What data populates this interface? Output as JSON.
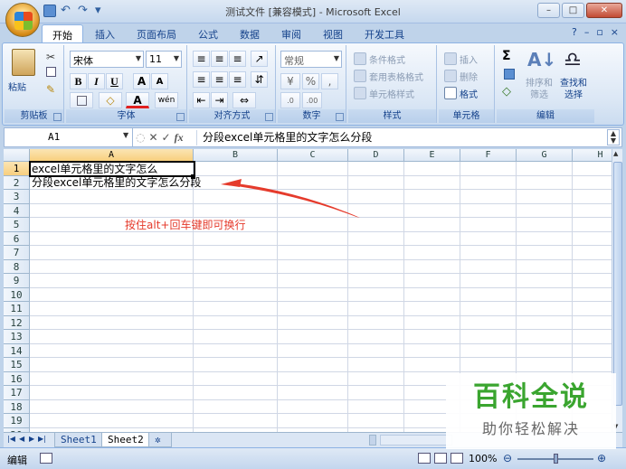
{
  "title": "测试文件  [兼容模式] - Microsoft Excel",
  "tabs": [
    "开始",
    "插入",
    "页面布局",
    "公式",
    "数据",
    "审阅",
    "视图",
    "开发工具"
  ],
  "ribbon": {
    "clipboard": {
      "paste": "粘贴",
      "label": "剪贴板"
    },
    "font": {
      "name": "宋体",
      "size": "11",
      "bold": "B",
      "italic": "I",
      "underline": "U",
      "grow": "A",
      "shrink": "A",
      "fontcolor": "A",
      "wen": "wén",
      "label": "字体"
    },
    "alignment": {
      "label": "对齐方式"
    },
    "number": {
      "format": "常规",
      "percent": "%",
      "comma": ",",
      "label": "数字"
    },
    "styles": {
      "cond": "条件格式",
      "table": "套用表格格式",
      "cell": "单元格样式",
      "label": "样式"
    },
    "cells": {
      "insert": "插入",
      "delete": "删除",
      "format": "格式",
      "label": "单元格"
    },
    "editing": {
      "sigma": "Σ",
      "sort": "排序和\n筛选",
      "find": "查找和\n选择",
      "label": "编辑"
    }
  },
  "namebox": "A1",
  "formula": "分段excel单元格里的文字怎么分段",
  "columns": [
    "A",
    "B",
    "C",
    "D",
    "E",
    "F",
    "G",
    "H"
  ],
  "rows": [
    "1",
    "2",
    "3",
    "4",
    "5",
    "6",
    "7",
    "8",
    "9",
    "10",
    "11",
    "12",
    "13",
    "14",
    "15",
    "16",
    "17",
    "18",
    "19",
    "20"
  ],
  "cells": {
    "a1": "excel单元格里的文字怎么",
    "a2": "分段excel单元格里的文字怎么分段"
  },
  "annotation": "按住alt+回车键即可换行",
  "sheets": [
    "Sheet1",
    "Sheet2"
  ],
  "status": {
    "mode": "编辑",
    "zoom": "100%"
  },
  "watermark": {
    "title": "百科全说",
    "subtitle": "助你轻松解决"
  },
  "colors": {
    "annotation": "#e53b2c",
    "arrow": "#e53b2c",
    "watermark": "#3aa52f"
  }
}
